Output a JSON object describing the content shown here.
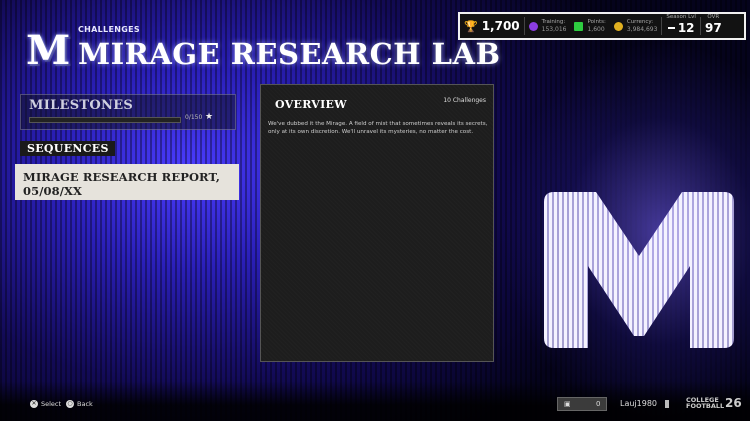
{
  "header": {
    "breadcrumb": "CHALLENGES",
    "title": "MIRAGE RESEARCH LAB",
    "logo_letter": "M"
  },
  "stats": {
    "trophies": "1,700",
    "training_label": "Training:",
    "training_value": "153,016",
    "points_label": "Points:",
    "points_value": "1,600",
    "currency_label": "Currency:",
    "currency_value": "3,984,693",
    "season_label": "Season Lvl",
    "season_value": "12",
    "ovr_label": "OVR",
    "ovr_value": "97"
  },
  "milestones": {
    "title": "MILESTONES",
    "count": "0/150",
    "progress": 0
  },
  "sequences": {
    "label": "SEQUENCES",
    "items": [
      {
        "label": "MIRAGE RESEARCH REPORT, 05/08/XX"
      }
    ]
  },
  "overview": {
    "title": "OVERVIEW",
    "challenges": "10 Challenges",
    "line1": "We've dubbed it the Mirage. A field of mist that sometimes reveals its secrets,",
    "line2": "only at its own discretion. We'll unravel its mysteries, no matter the cost."
  },
  "footer": {
    "select_label": "Select",
    "back_label": "Back",
    "party_count": "0",
    "gamertag": "Lauj1980",
    "brand_line1": "COLLEGE",
    "brand_line2": "FOOTBALL",
    "brand_year": "26"
  },
  "colors": {
    "accent_blue": "#2a1fb8",
    "panel_dark": "#1d1d1d",
    "selected_item": "#e6e3dc"
  }
}
